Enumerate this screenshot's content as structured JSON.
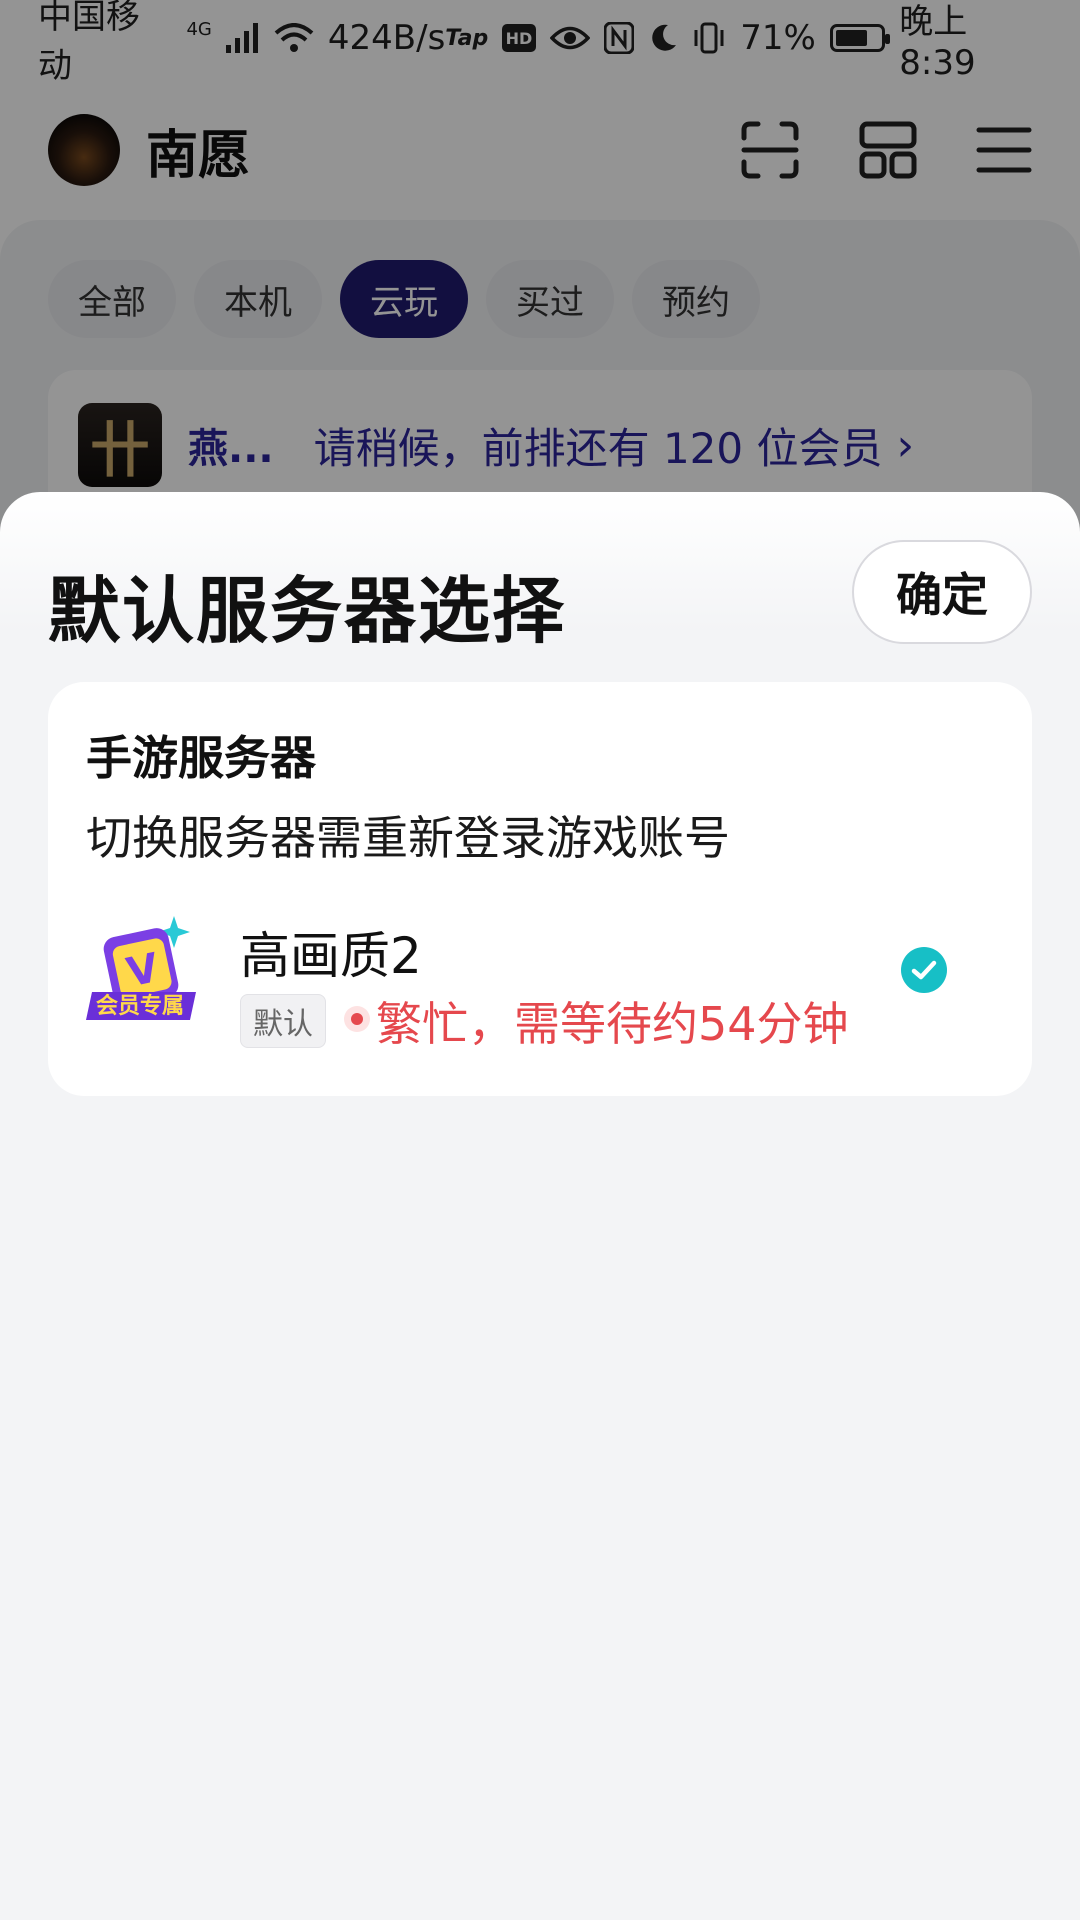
{
  "status_bar": {
    "carrier": "中国移动",
    "network": "4G",
    "speed": "424B/s",
    "battery_percent": "71%",
    "battery_level": 0.71,
    "time": "晚上8:39",
    "icons": [
      "signal-icon",
      "wifi-icon",
      "taptap-icon",
      "hd-icon",
      "eye-icon",
      "nfc-icon",
      "moon-icon",
      "vibrate-icon",
      "battery-icon"
    ]
  },
  "header": {
    "username": "南愿",
    "icons": [
      "scan-icon",
      "grid-icon",
      "menu-icon"
    ]
  },
  "tabs": [
    {
      "label": "全部",
      "active": false
    },
    {
      "label": "本机",
      "active": false
    },
    {
      "label": "云玩",
      "active": true
    },
    {
      "label": "买过",
      "active": false
    },
    {
      "label": "预约",
      "active": false
    }
  ],
  "queue": {
    "game_name": "燕...",
    "message": "请稍候，前排还有 120 位会员",
    "game_icon_glyph": "卄"
  },
  "sheet": {
    "title": "默认服务器选择",
    "confirm_label": "确定",
    "section_title": "手游服务器",
    "section_desc": "切换服务器需重新登录游戏账号",
    "server": {
      "name": "高画质2",
      "badge_letter": "V",
      "badge_text": "会员专属",
      "default_tag": "默认",
      "status": "繁忙，需等待约54分钟",
      "selected": true
    }
  },
  "colors": {
    "accent_tab": "#201a6f",
    "queue_text": "#2b2599",
    "busy_red": "#e5484d",
    "check_teal": "#17bfc6",
    "vip_purple": "#7b3fe4"
  }
}
